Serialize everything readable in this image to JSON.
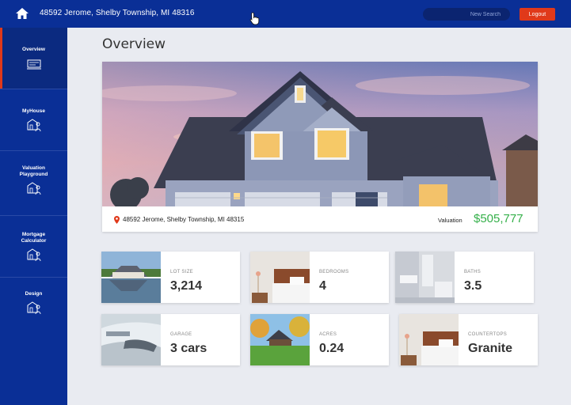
{
  "topbar": {
    "address": "48592 Jerome, Shelby Township, MI 48316",
    "search_placeholder": "New Search",
    "logout_label": "Logout"
  },
  "sidebar": {
    "items": [
      {
        "label": "Overview",
        "icon": "house-scan-icon",
        "active": true
      },
      {
        "label": "MyHouse",
        "icon": "house-person-icon"
      },
      {
        "label": "Valuation Playground",
        "icon": "house-person-icon"
      },
      {
        "label": "Mortgage Calculator",
        "icon": "house-person-icon"
      },
      {
        "label": "Design",
        "icon": "house-person-icon"
      }
    ]
  },
  "main": {
    "title": "Overview",
    "hero": {
      "address": "48592 Jerome, Shelby Township, MI 48315",
      "valuation_label": "Valuation",
      "valuation_value": "$505,777"
    },
    "cards": [
      {
        "label": "LOT SIZE",
        "value": "3,214",
        "image": "lake-house-photo"
      },
      {
        "label": "BEDROOMS",
        "value": "4",
        "image": "bedroom-photo"
      },
      {
        "label": "BATHS",
        "value": "3.5",
        "image": "bathroom-photo"
      },
      {
        "label": "GARAGE",
        "value": "3 cars",
        "image": "car-photo"
      },
      {
        "label": "ACRES",
        "value": "0.24",
        "image": "yard-house-photo"
      },
      {
        "label": "COUNTERTOPS",
        "value": "Granite",
        "image": "bedroom-photo"
      }
    ]
  },
  "colors": {
    "primary": "#0a2f96",
    "accent": "#e0391a",
    "valuation": "#35b04a",
    "background": "#e9ebf1"
  }
}
